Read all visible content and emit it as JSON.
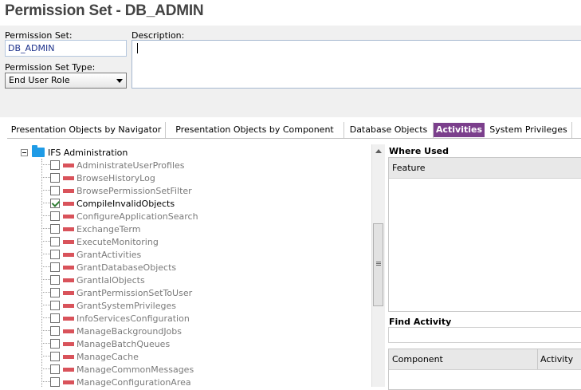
{
  "page": {
    "title": "Permission Set - DB_ADMIN"
  },
  "form": {
    "permission_set_label": "Permission Set:",
    "permission_set_value": "DB_ADMIN",
    "description_label": "Description:",
    "description_value": "",
    "type_label": "Permission Set Type:",
    "type_value": "End User Role"
  },
  "tabs": [
    {
      "label": "Presentation Objects by Navigator",
      "active": false
    },
    {
      "label": "Presentation Objects by Component",
      "active": false
    },
    {
      "label": "Database Objects",
      "active": false
    },
    {
      "label": "Activities",
      "active": true
    },
    {
      "label": "System Privileges",
      "active": false
    }
  ],
  "tree": {
    "root_label": "IFS Administration",
    "items": [
      {
        "label": "AdministrateUserProfiles",
        "checked": false
      },
      {
        "label": "BrowseHistoryLog",
        "checked": false
      },
      {
        "label": "BrowsePermissionSetFilter",
        "checked": false
      },
      {
        "label": "CompileInvalidObjects",
        "checked": true
      },
      {
        "label": "ConfigureApplicationSearch",
        "checked": false
      },
      {
        "label": "ExchangeTerm",
        "checked": false
      },
      {
        "label": "ExecuteMonitoring",
        "checked": false
      },
      {
        "label": "GrantActivities",
        "checked": false
      },
      {
        "label": "GrantDatabaseObjects",
        "checked": false
      },
      {
        "label": "GrantIalObjects",
        "checked": false
      },
      {
        "label": "GrantPermissionSetToUser",
        "checked": false
      },
      {
        "label": "GrantSystemPrivileges",
        "checked": false
      },
      {
        "label": "InfoServicesConfiguration",
        "checked": false
      },
      {
        "label": "ManageBackgroundJobs",
        "checked": false
      },
      {
        "label": "ManageBatchQueues",
        "checked": false
      },
      {
        "label": "ManageCache",
        "checked": false
      },
      {
        "label": "ManageCommonMessages",
        "checked": false
      },
      {
        "label": "ManageConfigurationArea",
        "checked": false
      }
    ]
  },
  "where_used": {
    "title": "Where Used",
    "column_feature": "Feature"
  },
  "find_activity": {
    "title": "Find Activity",
    "value": ""
  },
  "results": {
    "column_component": "Component",
    "column_activity": "Activity"
  },
  "colors": {
    "active_tab": "#7b3f8c",
    "folder": "#1f9be6",
    "activity_bar": "#d9535b",
    "check": "#2e7d32"
  }
}
